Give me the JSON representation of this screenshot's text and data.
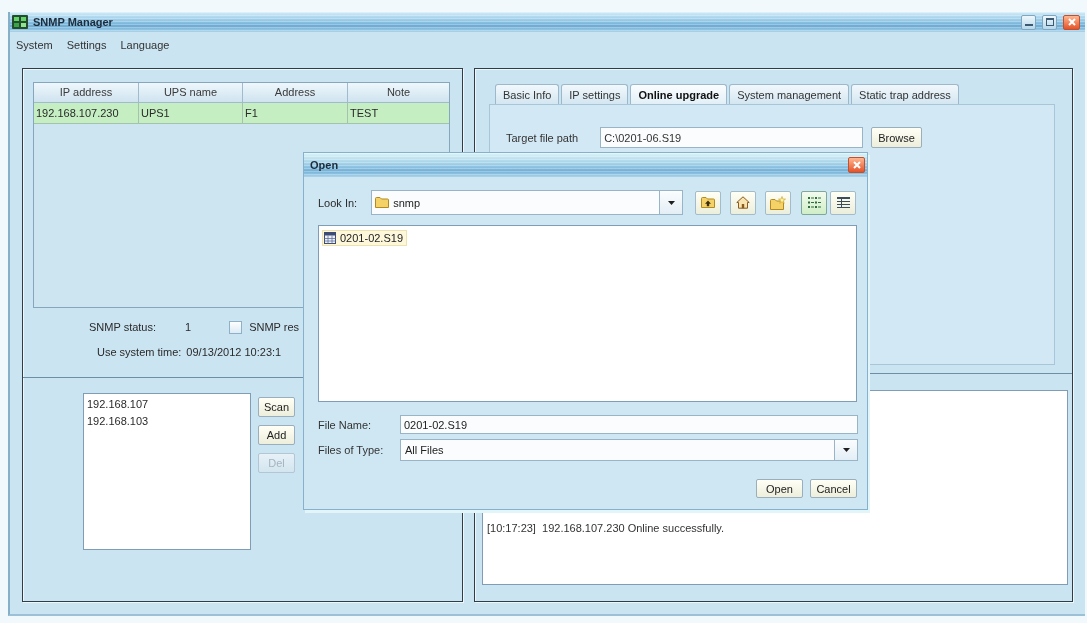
{
  "window": {
    "title": "SNMP Manager"
  },
  "menu": [
    "System",
    "Settings",
    "Language"
  ],
  "device_table": {
    "columns": [
      "IP address",
      "UPS name",
      "Address",
      "Note"
    ],
    "rows": [
      {
        "cells": [
          "192.168.107.230",
          "UPS1",
          "F1",
          "TEST"
        ],
        "selected": true
      }
    ]
  },
  "snmp_status": {
    "label": "SNMP status:",
    "value": "1"
  },
  "snmp_checkbox": {
    "label": "SNMP res",
    "checked": false
  },
  "system_time": {
    "label": "Use system time:",
    "value": "09/13/2012 10:23:1"
  },
  "scan_list": {
    "items": [
      "192.168.107",
      "192.168.103"
    ],
    "buttons": [
      {
        "label": "Scan",
        "disabled": false
      },
      {
        "label": "Add",
        "disabled": false
      },
      {
        "label": "Del",
        "disabled": true
      }
    ]
  },
  "tabs": [
    {
      "label": "Basic Info",
      "selected": false
    },
    {
      "label": "IP settings",
      "selected": false
    },
    {
      "label": "Online upgrade",
      "selected": true
    },
    {
      "label": "System management",
      "selected": false
    },
    {
      "label": "Static trap address",
      "selected": false
    }
  ],
  "online_upgrade": {
    "label": "Target file path",
    "value": "C:\\0201-06.S19",
    "button": "Browse"
  },
  "log": [
    "[10:17:23]  192.168.107.230 Online successfully."
  ],
  "open_dialog": {
    "title": "Open",
    "look_in": {
      "label": "Look In:",
      "value": "snmp"
    },
    "nav_buttons": [
      {
        "kind": "up-folder"
      },
      {
        "kind": "home"
      },
      {
        "kind": "new-folder"
      }
    ],
    "view_buttons": [
      {
        "kind": "list",
        "selected": true
      },
      {
        "kind": "details",
        "selected": false
      }
    ],
    "files": [
      {
        "name": "0201-02.S19",
        "selected": true
      }
    ],
    "file_name": {
      "label": "File Name:",
      "value": "0201-02.S19"
    },
    "file_type": {
      "label": "Files of Type:",
      "value": "All Files"
    },
    "buttons": [
      "Open",
      "Cancel"
    ]
  }
}
